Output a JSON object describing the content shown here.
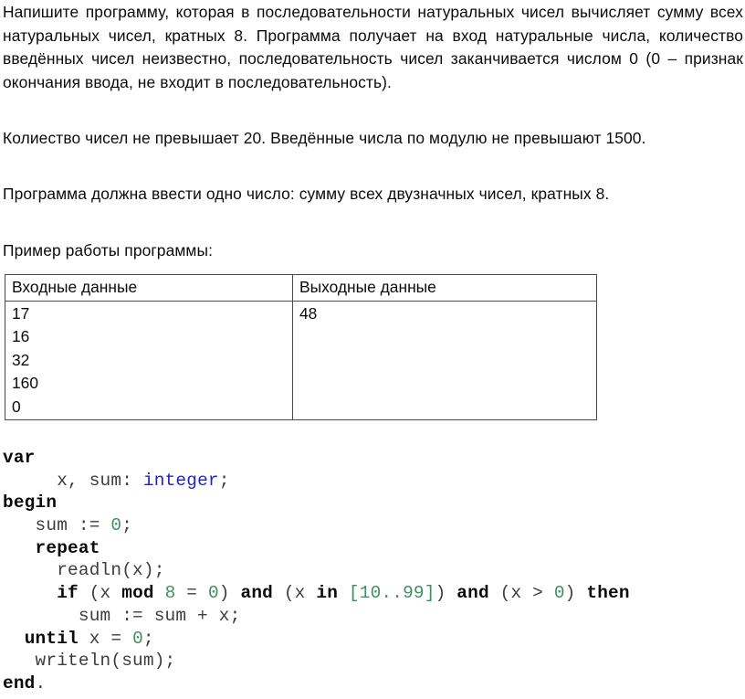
{
  "document": {
    "paragraphs": {
      "intro": "Напишите программу, которая в последовательности натуральных чисел вычисляет сумму всех натуральных чисел, кратных 8. Программа получает на вход натуральные числа, количество введённых чисел неизвестно, последовательность чисел заканчивается числом 0 (0 – признак окончания ввода, не входит в последовательность).",
      "limits": "Колиество чисел не превышает 20. Введённые числа по модулю не превышают 1500.",
      "output_requirement": "Программа должна ввести одно число: сумму всех двузначных чисел, кратных 8.",
      "example_caption": "Пример работы программы:"
    },
    "example_table": {
      "headers": [
        "Входные данные",
        "Выходные данные"
      ],
      "input_lines": [
        "17",
        "16",
        "32",
        "160",
        "0"
      ],
      "output_lines": [
        "48"
      ]
    },
    "code": {
      "language": "Pascal",
      "colors": {
        "keyword": "#0a0a0a",
        "type": "#2222cc",
        "number": "#3f8f63",
        "identifier": "#3d3d3d"
      },
      "lines": [
        {
          "id": "l1",
          "indent": "",
          "tokens": [
            {
              "t": "var",
              "c": "kw"
            }
          ]
        },
        {
          "id": "l2",
          "indent": "     ",
          "tokens": [
            {
              "t": "x, sum: ",
              "c": "id"
            },
            {
              "t": "integer",
              "c": "typ"
            },
            {
              "t": ";",
              "c": "pun"
            }
          ]
        },
        {
          "id": "l3",
          "indent": "",
          "tokens": [
            {
              "t": "begin",
              "c": "kw"
            }
          ]
        },
        {
          "id": "l4",
          "indent": "   ",
          "tokens": [
            {
              "t": "sum := ",
              "c": "id"
            },
            {
              "t": "0",
              "c": "num"
            },
            {
              "t": ";",
              "c": "pun"
            }
          ]
        },
        {
          "id": "l5",
          "indent": "   ",
          "tokens": [
            {
              "t": "repeat",
              "c": "kw"
            }
          ]
        },
        {
          "id": "l6",
          "indent": "     ",
          "tokens": [
            {
              "t": "readln(x);",
              "c": "id"
            }
          ]
        },
        {
          "id": "l7",
          "indent": "     ",
          "tokens": [
            {
              "t": "if",
              "c": "kw"
            },
            {
              "t": " (x ",
              "c": "id"
            },
            {
              "t": "mod",
              "c": "kw"
            },
            {
              "t": " ",
              "c": "id"
            },
            {
              "t": "8",
              "c": "num"
            },
            {
              "t": " = ",
              "c": "id"
            },
            {
              "t": "0",
              "c": "num"
            },
            {
              "t": ") ",
              "c": "id"
            },
            {
              "t": "and",
              "c": "kw"
            },
            {
              "t": " (x ",
              "c": "id"
            },
            {
              "t": "in",
              "c": "kw"
            },
            {
              "t": " ",
              "c": "id"
            },
            {
              "t": "[10..99]",
              "c": "num"
            },
            {
              "t": ") ",
              "c": "id"
            },
            {
              "t": "and",
              "c": "kw"
            },
            {
              "t": " (x > ",
              "c": "id"
            },
            {
              "t": "0",
              "c": "num"
            },
            {
              "t": ") ",
              "c": "id"
            },
            {
              "t": "then",
              "c": "kw"
            }
          ]
        },
        {
          "id": "l8",
          "indent": "       ",
          "tokens": [
            {
              "t": "sum := sum + x;",
              "c": "id"
            }
          ]
        },
        {
          "id": "l9",
          "indent": "  ",
          "tokens": [
            {
              "t": "until",
              "c": "kw"
            },
            {
              "t": " x = ",
              "c": "id"
            },
            {
              "t": "0",
              "c": "num"
            },
            {
              "t": ";",
              "c": "pun"
            }
          ]
        },
        {
          "id": "l10",
          "indent": "   ",
          "tokens": [
            {
              "t": "writeln(sum);",
              "c": "id"
            }
          ]
        },
        {
          "id": "l11",
          "indent": "",
          "tokens": [
            {
              "t": "end",
              "c": "kw"
            },
            {
              "t": ".",
              "c": "pun"
            }
          ]
        }
      ]
    }
  }
}
